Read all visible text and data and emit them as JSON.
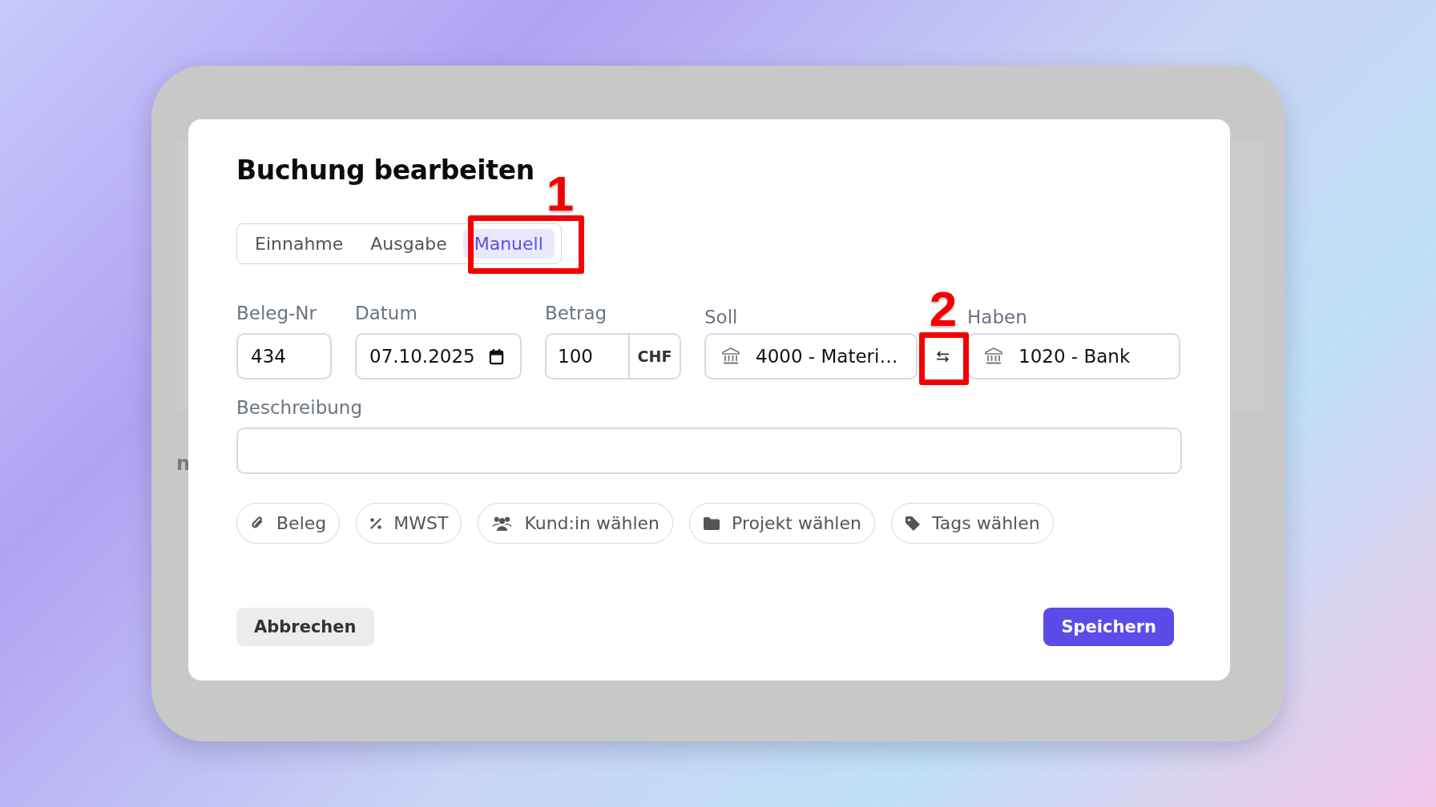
{
  "background": {
    "text": "n"
  },
  "dialog": {
    "title": "Buchung bearbeiten"
  },
  "tabs": [
    {
      "label": "Einnahme",
      "selected": false
    },
    {
      "label": "Ausgabe",
      "selected": false
    },
    {
      "label": "Manuell",
      "selected": true
    }
  ],
  "fields": [
    {
      "kind": "text",
      "label": "Beleg-Nr",
      "value": "434"
    },
    {
      "kind": "date",
      "label": "Datum",
      "value": "07.10.2025"
    },
    {
      "kind": "amount",
      "label": "Betrag",
      "value": "100",
      "unit": "CHF"
    }
  ],
  "accounts": {
    "debit": {
      "label": "Soll",
      "value": "4000 - Materi…"
    },
    "credit": {
      "label": "Haben",
      "value": "1020 - Bank"
    }
  },
  "description": {
    "label": "Beschreibung"
  },
  "chips": [
    {
      "kind": "attachment",
      "label": "Beleg"
    },
    {
      "kind": "percent",
      "label": "MWST"
    },
    {
      "kind": "people",
      "label": "Kund:in wählen"
    },
    {
      "kind": "folder",
      "label": "Projekt wählen"
    },
    {
      "kind": "tag",
      "label": "Tags wählen"
    }
  ],
  "buttons": {
    "cancel": "Abbrechen",
    "save": "Speichern"
  },
  "annotations": [
    {
      "label": "1"
    },
    {
      "label": "2"
    }
  ]
}
